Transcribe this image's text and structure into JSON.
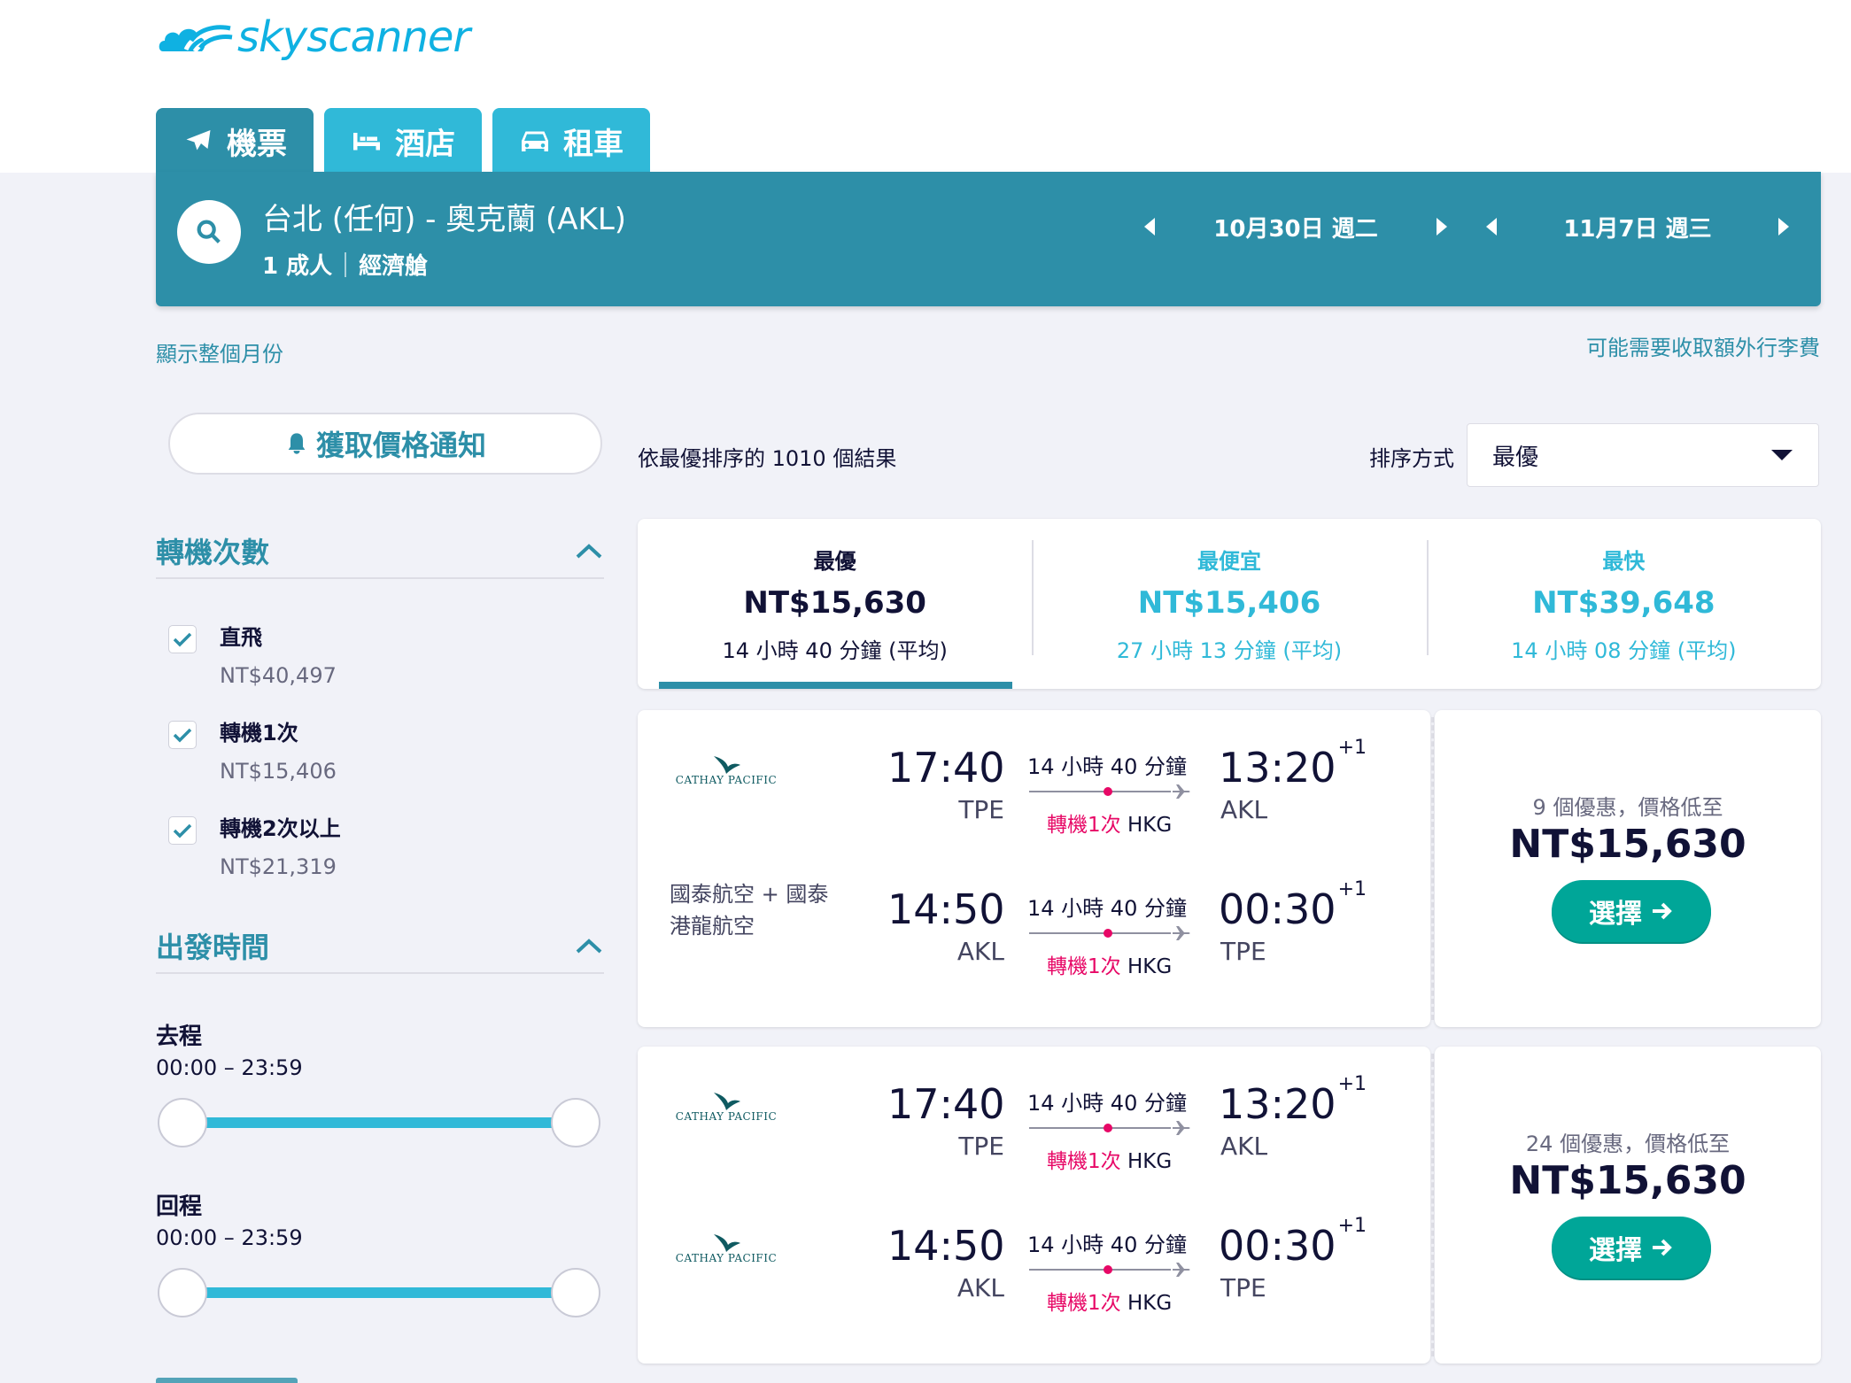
{
  "brand": {
    "name": "skyscanner",
    "color": "#0fb1e2"
  },
  "tabs": [
    {
      "label": "機票",
      "icon": "plane-icon",
      "active": true
    },
    {
      "label": "酒店",
      "icon": "bed-icon",
      "active": false
    },
    {
      "label": "租車",
      "icon": "car-icon",
      "active": false
    }
  ],
  "search": {
    "route": "台北 (任何) - 奧克蘭 (AKL)",
    "passengers": "1 成人",
    "cabin": "經濟艙",
    "depart_date": "10月30日 週二",
    "return_date": "11月7日 週三"
  },
  "links": {
    "whole_month": "顯示整個月份",
    "baggage": "可能需要收取額外行李費"
  },
  "price_alert": "獲取價格通知",
  "filters": {
    "stops_title": "轉機次數",
    "stops": [
      {
        "label": "直飛",
        "price": "NT$40,497",
        "checked": true
      },
      {
        "label": "轉機1次",
        "price": "NT$15,406",
        "checked": true
      },
      {
        "label": "轉機2次以上",
        "price": "NT$21,319",
        "checked": true
      }
    ],
    "times_title": "出發時間",
    "outbound_label": "去程",
    "outbound_range": "00:00 – 23:59",
    "inbound_label": "回程",
    "inbound_range": "00:00 – 23:59"
  },
  "results": {
    "count_text": "依最優排序的 1010 個結果",
    "sort_label": "排序方式",
    "sort_value": "最優"
  },
  "summary": [
    {
      "title": "最優",
      "price": "NT$15,630",
      "duration": "14 小時 40 分鐘 (平均)",
      "active": true
    },
    {
      "title": "最便宜",
      "price": "NT$15,406",
      "duration": "27 小時 13 分鐘 (平均)",
      "active": false
    },
    {
      "title": "最快",
      "price": "NT$39,648",
      "duration": "14 小時 08 分鐘 (平均)",
      "active": false
    }
  ],
  "itineraries": [
    {
      "deals": "9 個優惠，價格低至",
      "price": "NT$15,630",
      "select_label": "選擇",
      "legs": [
        {
          "airline_logo_text": "CATHAY PACIFIC",
          "airline_name": "",
          "dep_time": "17:40",
          "dep_ap": "TPE",
          "duration": "14 小時 40 分鐘",
          "stops": "轉機1次",
          "via": "HKG",
          "arr_time": "13:20",
          "arr_offset": "+1",
          "arr_ap": "AKL"
        },
        {
          "airline_logo_text": "",
          "airline_name": "國泰航空 + 國泰港龍航空",
          "dep_time": "14:50",
          "dep_ap": "AKL",
          "duration": "14 小時 40 分鐘",
          "stops": "轉機1次",
          "via": "HKG",
          "arr_time": "00:30",
          "arr_offset": "+1",
          "arr_ap": "TPE"
        }
      ]
    },
    {
      "deals": "24 個優惠，價格低至",
      "price": "NT$15,630",
      "select_label": "選擇",
      "legs": [
        {
          "airline_logo_text": "CATHAY PACIFIC",
          "airline_name": "",
          "dep_time": "17:40",
          "dep_ap": "TPE",
          "duration": "14 小時 40 分鐘",
          "stops": "轉機1次",
          "via": "HKG",
          "arr_time": "13:20",
          "arr_offset": "+1",
          "arr_ap": "AKL"
        },
        {
          "airline_logo_text": "CATHAY PACIFIC",
          "airline_name": "",
          "dep_time": "14:50",
          "dep_ap": "AKL",
          "duration": "14 小時 40 分鐘",
          "stops": "轉機1次",
          "via": "HKG",
          "arr_time": "00:30",
          "arr_offset": "+1",
          "arr_ap": "TPE"
        }
      ]
    }
  ],
  "colors": {
    "primary": "#2d8fa8",
    "tab": "#30b9d8",
    "accent_link": "#30b9d8",
    "select_button": "#00a698",
    "stop_red": "#e70866"
  }
}
